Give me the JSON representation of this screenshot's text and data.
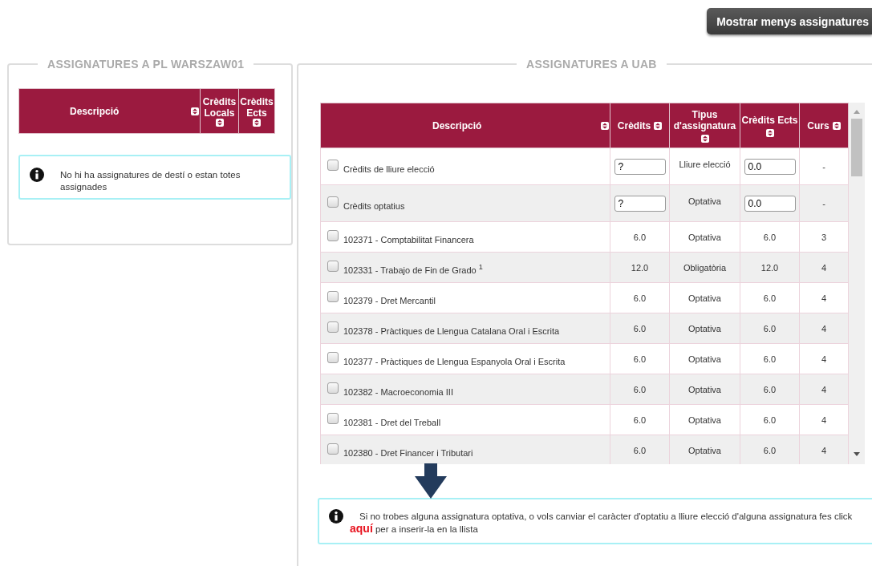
{
  "show_less_button": "Mostrar menys assignatures",
  "left_panel": {
    "title": "ASSIGNATURES A PL WARSZAW01",
    "columns": [
      {
        "label": "Descripció"
      },
      {
        "label": "Crèdits Locals"
      },
      {
        "label": "Crèdits Ects"
      }
    ],
    "notice": "No hi ha assignatures de destí o estan totes assignades"
  },
  "right_panel": {
    "title": "ASSIGNATURES A UAB",
    "columns": [
      {
        "label": "Descripció"
      },
      {
        "label": "Crèdits"
      },
      {
        "label": "Tipus d'assignatura"
      },
      {
        "label": "Crèdits Ects"
      },
      {
        "label": "Curs"
      }
    ],
    "rows": [
      {
        "kind": "input",
        "checked": false,
        "description": "Crèdits de lliure elecció",
        "credits": "?",
        "type": "Lliure elecció",
        "ects": "0.0",
        "course": "-"
      },
      {
        "kind": "input",
        "checked": false,
        "description": "Crèdits optatius",
        "credits": "?",
        "type": "Optativa",
        "ects": "0.0",
        "course": "-"
      },
      {
        "kind": "fixed",
        "checked": false,
        "description": "102371 - Comptabilitat Financera",
        "credits": "6.0",
        "type": "Optativa",
        "ects": "6.0",
        "course": "3"
      },
      {
        "kind": "fixed",
        "checked": false,
        "description": "102331 - Trabajo de Fin de Grado $^{1}$",
        "credits": "12.0",
        "type": "Obligatòria",
        "ects": "12.0",
        "course": "4"
      },
      {
        "kind": "fixed",
        "checked": false,
        "description": "102379 - Dret Mercantil",
        "credits": "6.0",
        "type": "Optativa",
        "ects": "6.0",
        "course": "4"
      },
      {
        "kind": "fixed",
        "checked": false,
        "description": "102378 - Pràctiques de Llengua Catalana Oral i Escrita",
        "credits": "6.0",
        "type": "Optativa",
        "ects": "6.0",
        "course": "4"
      },
      {
        "kind": "fixed",
        "checked": false,
        "description": "102377 - Pràctiques de Llengua Espanyola Oral i Escrita",
        "credits": "6.0",
        "type": "Optativa",
        "ects": "6.0",
        "course": "4"
      },
      {
        "kind": "fixed",
        "checked": false,
        "description": "102382 - Macroeconomia III",
        "credits": "6.0",
        "type": "Optativa",
        "ects": "6.0",
        "course": "4"
      },
      {
        "kind": "fixed",
        "checked": false,
        "description": "102381 - Dret del Treball",
        "credits": "6.0",
        "type": "Optativa",
        "ects": "6.0",
        "course": "4"
      },
      {
        "kind": "fixed",
        "checked": false,
        "description": "102380 - Dret Financer i Tributari",
        "credits": "6.0",
        "type": "Optativa",
        "ects": "6.0",
        "course": "4"
      }
    ],
    "notice": {
      "before": "Si no trobes alguna assignatura optativa, o vols canviar el caràcter d'optatiu a lliure elecció d'alguna assignatura fes click ",
      "link": "aquí",
      "after": " per a inserir-la en la llista"
    }
  }
}
